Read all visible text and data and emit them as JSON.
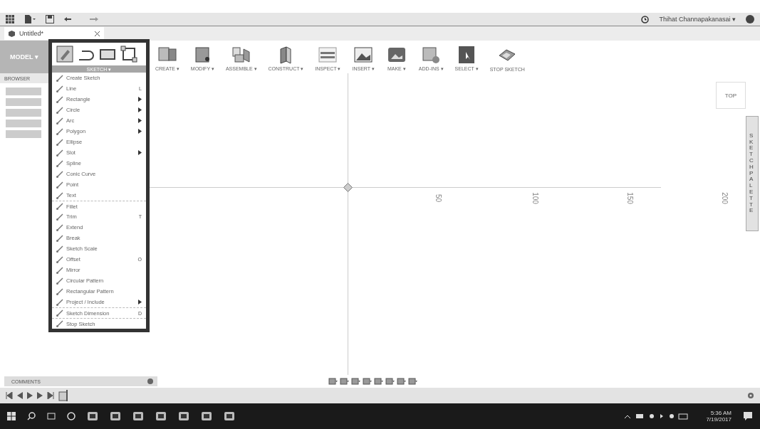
{
  "quick_access": {
    "user": "Thihat Channapakanasai ▾"
  },
  "document_tab": {
    "title": "Untitled*"
  },
  "workspace": {
    "label": "MODEL ▾"
  },
  "toolbar": [
    {
      "label": "CREATE ▾",
      "kind": "create"
    },
    {
      "label": "MODIFY ▾",
      "kind": "modify"
    },
    {
      "label": "ASSEMBLE ▾",
      "kind": "assemble"
    },
    {
      "label": "CONSTRUCT ▾",
      "kind": "construct"
    },
    {
      "label": "INSPECT ▾",
      "kind": "inspect"
    },
    {
      "label": "INSERT ▾",
      "kind": "insert"
    },
    {
      "label": "MAKE ▾",
      "kind": "make"
    },
    {
      "label": "ADD-INS ▾",
      "kind": "addins"
    },
    {
      "label": "SELECT ▾",
      "kind": "select"
    },
    {
      "label": "STOP SKETCH",
      "kind": "stop"
    }
  ],
  "browser": {
    "title": "BROWSER"
  },
  "sketch_menu": {
    "title": "SKETCH ▾",
    "items": [
      {
        "label": "Create Sketch",
        "submenu": false,
        "separator": false
      },
      {
        "label": "Line",
        "shortcut": "L",
        "submenu": false,
        "separator": false
      },
      {
        "label": "Rectangle",
        "submenu": true,
        "separator": false
      },
      {
        "label": "Circle",
        "submenu": true,
        "separator": false
      },
      {
        "label": "Arc",
        "submenu": true,
        "separator": false
      },
      {
        "label": "Polygon",
        "submenu": true,
        "separator": false
      },
      {
        "label": "Ellipse",
        "submenu": false,
        "separator": false
      },
      {
        "label": "Slot",
        "submenu": true,
        "separator": false
      },
      {
        "label": "Spline",
        "submenu": false,
        "separator": false
      },
      {
        "label": "Conic Curve",
        "submenu": false,
        "separator": false
      },
      {
        "label": "Point",
        "submenu": false,
        "separator": false
      },
      {
        "label": "Text",
        "submenu": false,
        "separator": false
      },
      {
        "label": "Fillet",
        "submenu": false,
        "separator": true
      },
      {
        "label": "Trim",
        "shortcut": "T",
        "submenu": false,
        "separator": false
      },
      {
        "label": "Extend",
        "submenu": false,
        "separator": false
      },
      {
        "label": "Break",
        "submenu": false,
        "separator": false
      },
      {
        "label": "Sketch Scale",
        "submenu": false,
        "separator": false
      },
      {
        "label": "Offset",
        "shortcut": "O",
        "submenu": false,
        "separator": false
      },
      {
        "label": "Mirror",
        "submenu": false,
        "separator": false
      },
      {
        "label": "Circular Pattern",
        "submenu": false,
        "separator": false
      },
      {
        "label": "Rectangular Pattern",
        "submenu": false,
        "separator": false
      },
      {
        "label": "Project / Include",
        "submenu": true,
        "separator": false
      },
      {
        "label": "Sketch Dimension",
        "shortcut": "D",
        "submenu": false,
        "separator": true
      },
      {
        "label": "Stop Sketch",
        "submenu": false,
        "separator": true
      }
    ]
  },
  "canvas": {
    "axis_labels": [
      "50",
      "100",
      "150",
      "200"
    ],
    "view_cube": "TOP",
    "palette": "SKETCH PALETTE"
  },
  "comments": {
    "title": "COMMENTS"
  },
  "taskbar": {
    "time": "5:36 AM",
    "date": "7/19/2017"
  }
}
